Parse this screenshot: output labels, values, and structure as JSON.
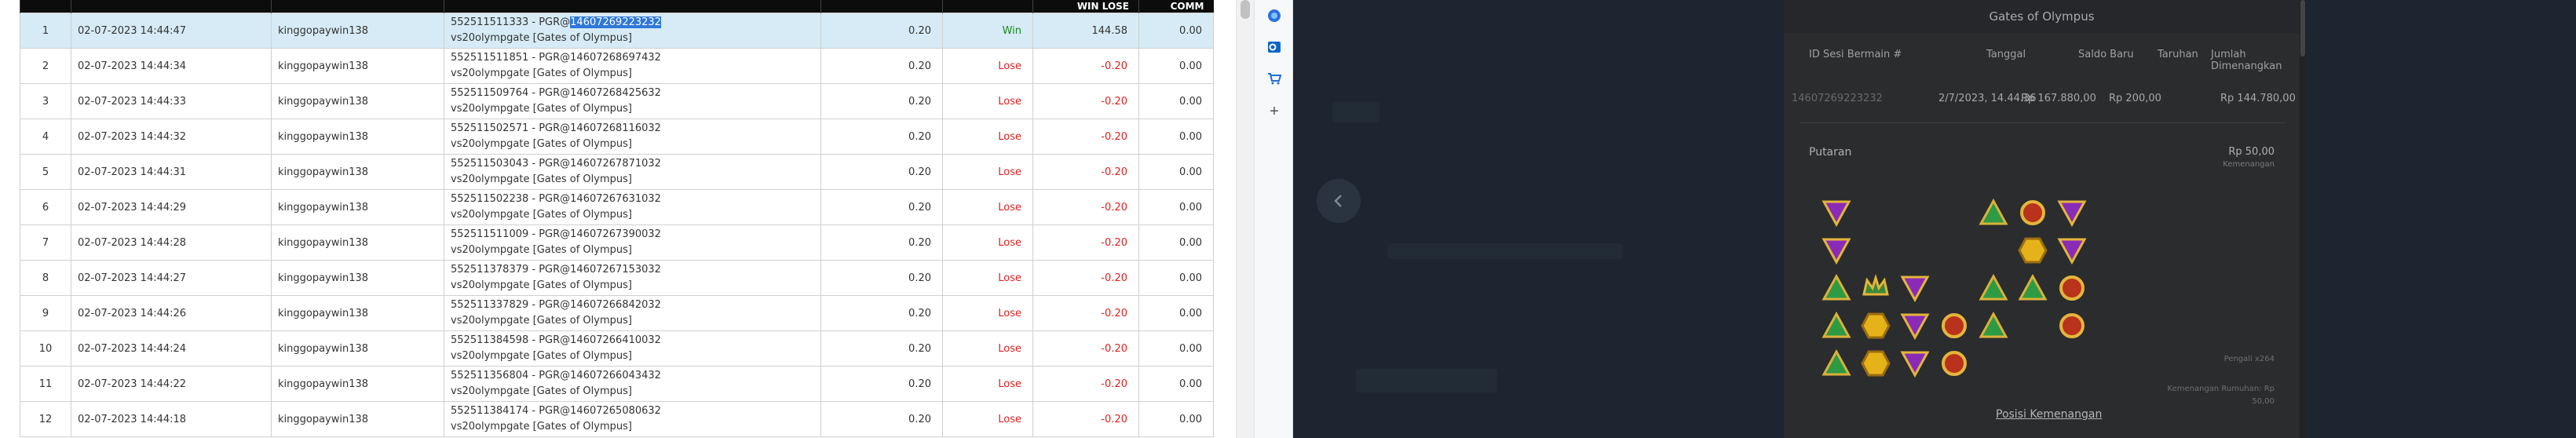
{
  "report": {
    "headers": [
      "",
      "",
      "",
      "",
      "",
      "",
      "WIN LOSE",
      "COMM"
    ],
    "selected_row": 0,
    "rows": [
      {
        "no": "1",
        "datetime": "02-07-2023 14:44:47",
        "user": "kinggopaywin138",
        "game_prefix": "552511511333 - PGR@",
        "game_id": "14607269223232",
        "game_name": "vs20olympgate [Gates of Olympus]",
        "bet": "0.20",
        "result": "Win",
        "winlose": "144.58",
        "comm": "0.00"
      },
      {
        "no": "2",
        "datetime": "02-07-2023 14:44:34",
        "user": "kinggopaywin138",
        "game_prefix": "552511511851 - PGR@",
        "game_id": "14607268697432",
        "game_name": "vs20olympgate [Gates of Olympus]",
        "bet": "0.20",
        "result": "Lose",
        "winlose": "-0.20",
        "comm": "0.00"
      },
      {
        "no": "3",
        "datetime": "02-07-2023 14:44:33",
        "user": "kinggopaywin138",
        "game_prefix": "552511509764 - PGR@",
        "game_id": "14607268425632",
        "game_name": "vs20olympgate [Gates of Olympus]",
        "bet": "0.20",
        "result": "Lose",
        "winlose": "-0.20",
        "comm": "0.00"
      },
      {
        "no": "4",
        "datetime": "02-07-2023 14:44:32",
        "user": "kinggopaywin138",
        "game_prefix": "552511502571 - PGR@",
        "game_id": "14607268116032",
        "game_name": "vs20olympgate [Gates of Olympus]",
        "bet": "0.20",
        "result": "Lose",
        "winlose": "-0.20",
        "comm": "0.00"
      },
      {
        "no": "5",
        "datetime": "02-07-2023 14:44:31",
        "user": "kinggopaywin138",
        "game_prefix": "552511503043 - PGR@",
        "game_id": "14607267871032",
        "game_name": "vs20olympgate [Gates of Olympus]",
        "bet": "0.20",
        "result": "Lose",
        "winlose": "-0.20",
        "comm": "0.00"
      },
      {
        "no": "6",
        "datetime": "02-07-2023 14:44:29",
        "user": "kinggopaywin138",
        "game_prefix": "552511502238 - PGR@",
        "game_id": "14607267631032",
        "game_name": "vs20olympgate [Gates of Olympus]",
        "bet": "0.20",
        "result": "Lose",
        "winlose": "-0.20",
        "comm": "0.00"
      },
      {
        "no": "7",
        "datetime": "02-07-2023 14:44:28",
        "user": "kinggopaywin138",
        "game_prefix": "552511511009 - PGR@",
        "game_id": "14607267390032",
        "game_name": "vs20olympgate [Gates of Olympus]",
        "bet": "0.20",
        "result": "Lose",
        "winlose": "-0.20",
        "comm": "0.00"
      },
      {
        "no": "8",
        "datetime": "02-07-2023 14:44:27",
        "user": "kinggopaywin138",
        "game_prefix": "552511378379 - PGR@",
        "game_id": "14607267153032",
        "game_name": "vs20olympgate [Gates of Olympus]",
        "bet": "0.20",
        "result": "Lose",
        "winlose": "-0.20",
        "comm": "0.00"
      },
      {
        "no": "9",
        "datetime": "02-07-2023 14:44:26",
        "user": "kinggopaywin138",
        "game_prefix": "552511337829 - PGR@",
        "game_id": "14607266842032",
        "game_name": "vs20olympgate [Gates of Olympus]",
        "bet": "0.20",
        "result": "Lose",
        "winlose": "-0.20",
        "comm": "0.00"
      },
      {
        "no": "10",
        "datetime": "02-07-2023 14:44:24",
        "user": "kinggopaywin138",
        "game_prefix": "552511384598 - PGR@",
        "game_id": "14607266410032",
        "game_name": "vs20olympgate [Gates of Olympus]",
        "bet": "0.20",
        "result": "Lose",
        "winlose": "-0.20",
        "comm": "0.00"
      },
      {
        "no": "11",
        "datetime": "02-07-2023 14:44:22",
        "user": "kinggopaywin138",
        "game_prefix": "552511356804 - PGR@",
        "game_id": "14607266043432",
        "game_name": "vs20olympgate [Gates of Olympus]",
        "bet": "0.20",
        "result": "Lose",
        "winlose": "-0.20",
        "comm": "0.00"
      },
      {
        "no": "12",
        "datetime": "02-07-2023 14:44:18",
        "user": "kinggopaywin138",
        "game_prefix": "552511384174 - PGR@",
        "game_id": "14607265080632",
        "game_name": "vs20olympgate [Gates of Olympus]",
        "bet": "0.20",
        "result": "Lose",
        "winlose": "-0.20",
        "comm": "0.00"
      }
    ]
  },
  "sidebar": {
    "icons": [
      "copilot-icon",
      "outlook-icon",
      "shopping-icon",
      "add-icon"
    ],
    "add_label": "+"
  },
  "dialog": {
    "title": "Gates of Olympus",
    "headers": {
      "session": "ID Sesi Bermain #",
      "date": "Tanggal",
      "balance": "Saldo Baru",
      "bet": "Taruhan",
      "win": "Jumlah Dimenangkan"
    },
    "values": {
      "session": "14607269223232",
      "date": "2/7/2023, 14.44.36",
      "balance": "Rp 167.880,00",
      "bet": "Rp 200,00",
      "win": "Rp 144.780,00"
    },
    "spin_label": "Putaran",
    "spin_win": "Rp 50,00",
    "spin_win_sub": "Kemenangan",
    "multiplier": "Pengali x264",
    "total_win": "Kemenangan Rumuhan: Rp 50,00",
    "positions_link": "Posisi Kemenangan",
    "back_icon": "chevron-left-icon"
  },
  "colors": {
    "selected_row": "#d6ebf5",
    "win": "#1a8a1a",
    "lose": "#e02020",
    "highlight": "#2f78d8",
    "dialog_bg": "#2a2c2e"
  }
}
